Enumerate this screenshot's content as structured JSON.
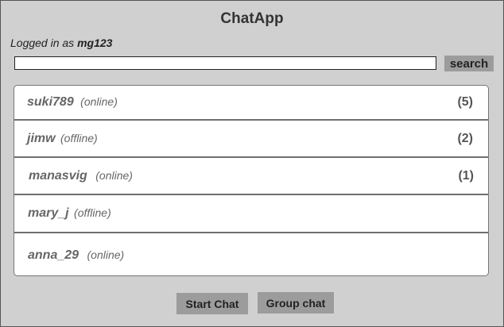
{
  "app": {
    "title": "ChatApp"
  },
  "user": {
    "prefix": "Logged in as ",
    "username": "mg123"
  },
  "search": {
    "value": "",
    "placeholder": "",
    "button_label": "search"
  },
  "contacts": [
    {
      "name": "suki789",
      "status": "(online)",
      "unread": "(5)"
    },
    {
      "name": "jimw",
      "status": "(offline)",
      "unread": "(2)"
    },
    {
      "name": "manasvig",
      "status": "(online)",
      "unread": "(1)"
    },
    {
      "name": "mary_j",
      "status": "(offline)",
      "unread": ""
    },
    {
      "name": "anna_29",
      "status": "(online)",
      "unread": ""
    }
  ],
  "actions": {
    "start_chat_label": "Start Chat",
    "group_chat_label": "Group chat"
  }
}
